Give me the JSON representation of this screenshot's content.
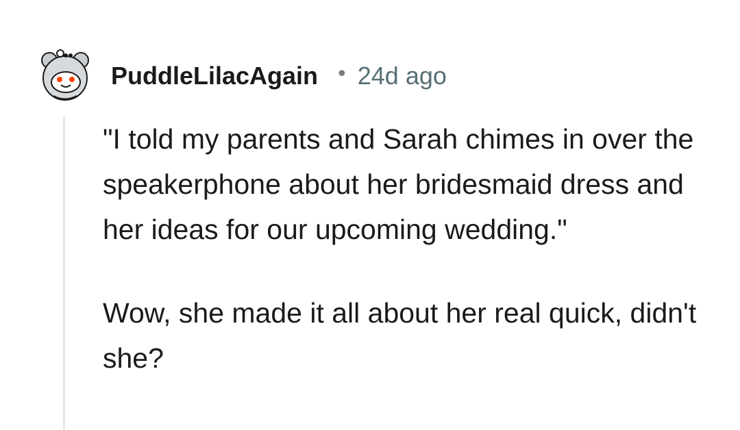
{
  "comment": {
    "author": "PuddleLilacAgain",
    "separator": "•",
    "timestamp": "24d ago",
    "avatar_icon": "snoo-koala-avatar-icon",
    "paragraphs": [
      "\"I told my parents and Sarah chimes in over the speakerphone about her bridesmaid dress and her ideas for our upcoming wedding.\"",
      "Wow, she made it all about her real quick, didn't she?"
    ]
  },
  "colors": {
    "text": "#1a1a1b",
    "meta": "#576f76",
    "thread_line": "#e5e5e5",
    "avatar_bg": "#d7dadc",
    "avatar_accent": "#ff4500"
  }
}
